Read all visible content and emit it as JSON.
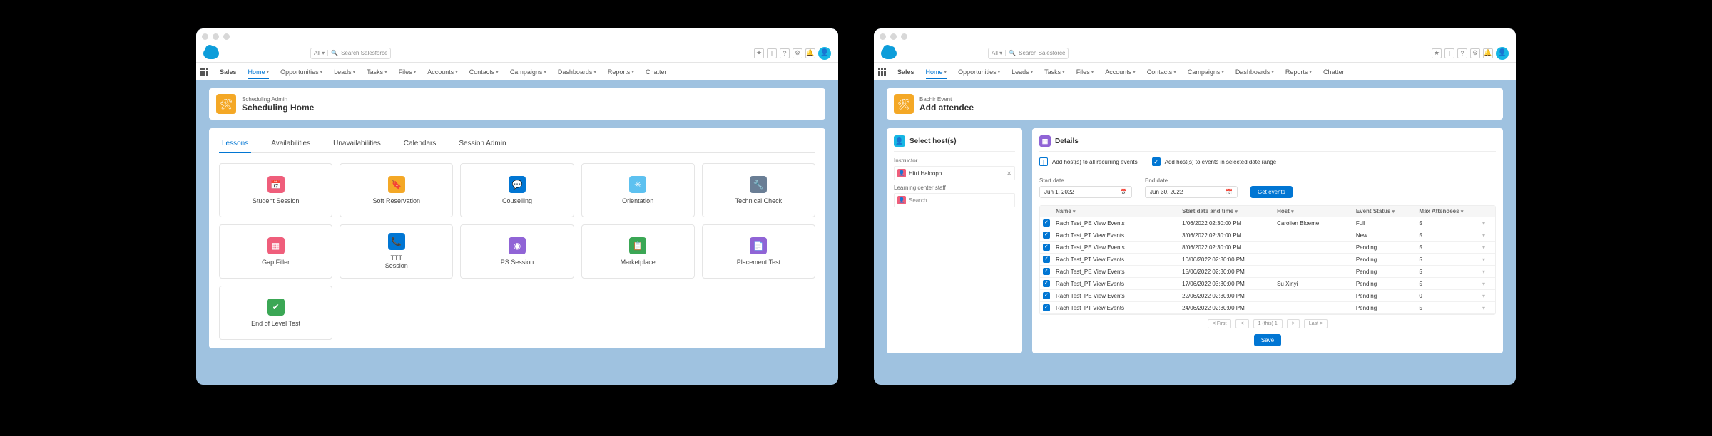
{
  "search": {
    "selector": "All ▾",
    "placeholder": "Search Salesforce"
  },
  "nav": {
    "app": "Sales",
    "items": [
      "Home",
      "Opportunities",
      "Leads",
      "Tasks",
      "Files",
      "Accounts",
      "Contacts",
      "Campaigns",
      "Dashboards",
      "Reports",
      "Chatter"
    ]
  },
  "win1": {
    "header": {
      "eyebrow": "Scheduling Admin",
      "title": "Scheduling Home"
    },
    "tabs": [
      "Lessons",
      "Availabilities",
      "Unavailabilities",
      "Calendars",
      "Session Admin"
    ],
    "cards": [
      {
        "label": "Student Session",
        "icon": "calendar",
        "color": "#ef5e7b"
      },
      {
        "label": "Soft Reservation",
        "icon": "bookmark",
        "color": "#f4a826"
      },
      {
        "label": "Couselling",
        "icon": "chat",
        "color": "#0176d3"
      },
      {
        "label": "Orientation",
        "icon": "star",
        "color": "#5dc1f0"
      },
      {
        "label": "Technical Check",
        "icon": "wrench",
        "color": "#6a7e95"
      },
      {
        "label": "Gap Filler",
        "icon": "grid",
        "color": "#ef5e7b"
      },
      {
        "label": "TTT\nSession",
        "icon": "phone",
        "color": "#0176d3"
      },
      {
        "label": "PS Session",
        "icon": "knob",
        "color": "#9064d6"
      },
      {
        "label": "Marketplace",
        "icon": "clipboard",
        "color": "#3ba755"
      },
      {
        "label": "Placement Test",
        "icon": "doc",
        "color": "#9064d6"
      },
      {
        "label": "End of Level Test",
        "icon": "check",
        "color": "#3ba755"
      }
    ]
  },
  "win2": {
    "header": {
      "eyebrow": "Bachir Event",
      "title": "Add attendee"
    },
    "hosts": {
      "section": "Select host(s)",
      "instLabel": "Instructor",
      "instructor": "Hitri Haloopo",
      "staffLabel": "Learning center staff",
      "staffPlaceholder": "Search"
    },
    "details": {
      "section": "Details",
      "opt1": "Add host(s) to all recurring events",
      "opt2": "Add host(s) to events in selected date range",
      "startLabel": "Start date",
      "start": "Jun 1, 2022",
      "endLabel": "End date",
      "end": "Jun 30, 2022",
      "getBtn": "Get events",
      "cols": [
        "Name",
        "Start date and time",
        "Host",
        "Event Status",
        "Max Attendees"
      ],
      "rows": [
        {
          "chk": true,
          "name": "Rach Test_PE View Events",
          "dt": "1/06/2022 02:30:00 PM",
          "host": "Carolien Bloeme",
          "status": "Full",
          "max": "5"
        },
        {
          "chk": true,
          "name": "Rach Test_PT View Events",
          "dt": "3/06/2022 02:30:00 PM",
          "host": "",
          "status": "New",
          "max": "5"
        },
        {
          "chk": true,
          "name": "Rach Test_PE View Events",
          "dt": "8/06/2022 02:30:00 PM",
          "host": "",
          "status": "Pending",
          "max": "5"
        },
        {
          "chk": true,
          "name": "Rach Test_PT View Events",
          "dt": "10/06/2022 02:30:00 PM",
          "host": "",
          "status": "Pending",
          "max": "5"
        },
        {
          "chk": true,
          "name": "Rach Test_PE View Events",
          "dt": "15/06/2022 02:30:00 PM",
          "host": "",
          "status": "Pending",
          "max": "5"
        },
        {
          "chk": true,
          "name": "Rach Test_PT View Events",
          "dt": "17/06/2022 03:30:00 PM",
          "host": "Su Xinyi",
          "status": "Pending",
          "max": "5"
        },
        {
          "chk": true,
          "name": "Rach Test_PE View Events",
          "dt": "22/06/2022 02:30:00 PM",
          "host": "",
          "status": "Pending",
          "max": "0"
        },
        {
          "chk": true,
          "name": "Rach Test_PT View Events",
          "dt": "24/06/2022 02:30:00 PM",
          "host": "",
          "status": "Pending",
          "max": "5"
        }
      ],
      "pager": [
        "< First",
        "<",
        "1 (this) 1",
        ">",
        "Last >"
      ],
      "save": "Save"
    }
  }
}
